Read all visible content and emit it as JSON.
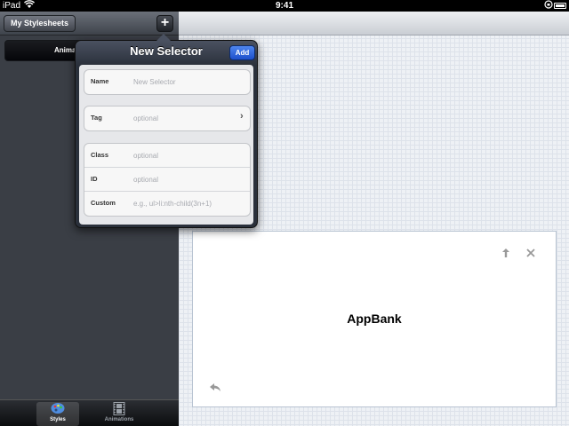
{
  "status_bar": {
    "carrier": "iPad",
    "wifi_icon": "wifi-icon",
    "time": "9:41",
    "lock_icon": "rotation-lock-icon",
    "battery_icon": "battery-icon"
  },
  "sidebar": {
    "stylesheets_button": "My Stylesheets",
    "add_button": "+",
    "segment_label": "Animati",
    "tabs": [
      {
        "label": "Styles",
        "icon": "palette-icon",
        "active": true
      },
      {
        "label": "Animations",
        "icon": "film-icon",
        "active": false
      }
    ]
  },
  "popover": {
    "title": "New Selector",
    "add_button": "Add",
    "fields": {
      "name": {
        "label": "Name",
        "value": "",
        "placeholder": "New Selector"
      },
      "tag": {
        "label": "Tag",
        "value": "",
        "placeholder": "optional"
      },
      "class": {
        "label": "Class",
        "value": "",
        "placeholder": "optional"
      },
      "id": {
        "label": "ID",
        "value": "",
        "placeholder": "optional"
      },
      "custom": {
        "label": "Custom",
        "value": "",
        "placeholder": "e.g., ul>li:nth-child(3n+1)"
      }
    }
  },
  "preview": {
    "title": "AppBank",
    "up_icon": "arrow-up-icon",
    "close_icon": "close-icon",
    "back_icon": "undo-icon"
  },
  "colors": {
    "sidebar_bg": "#3a3e45",
    "add_button_blue": "#2f62dc",
    "canvas_bg": "#eef1f5"
  }
}
